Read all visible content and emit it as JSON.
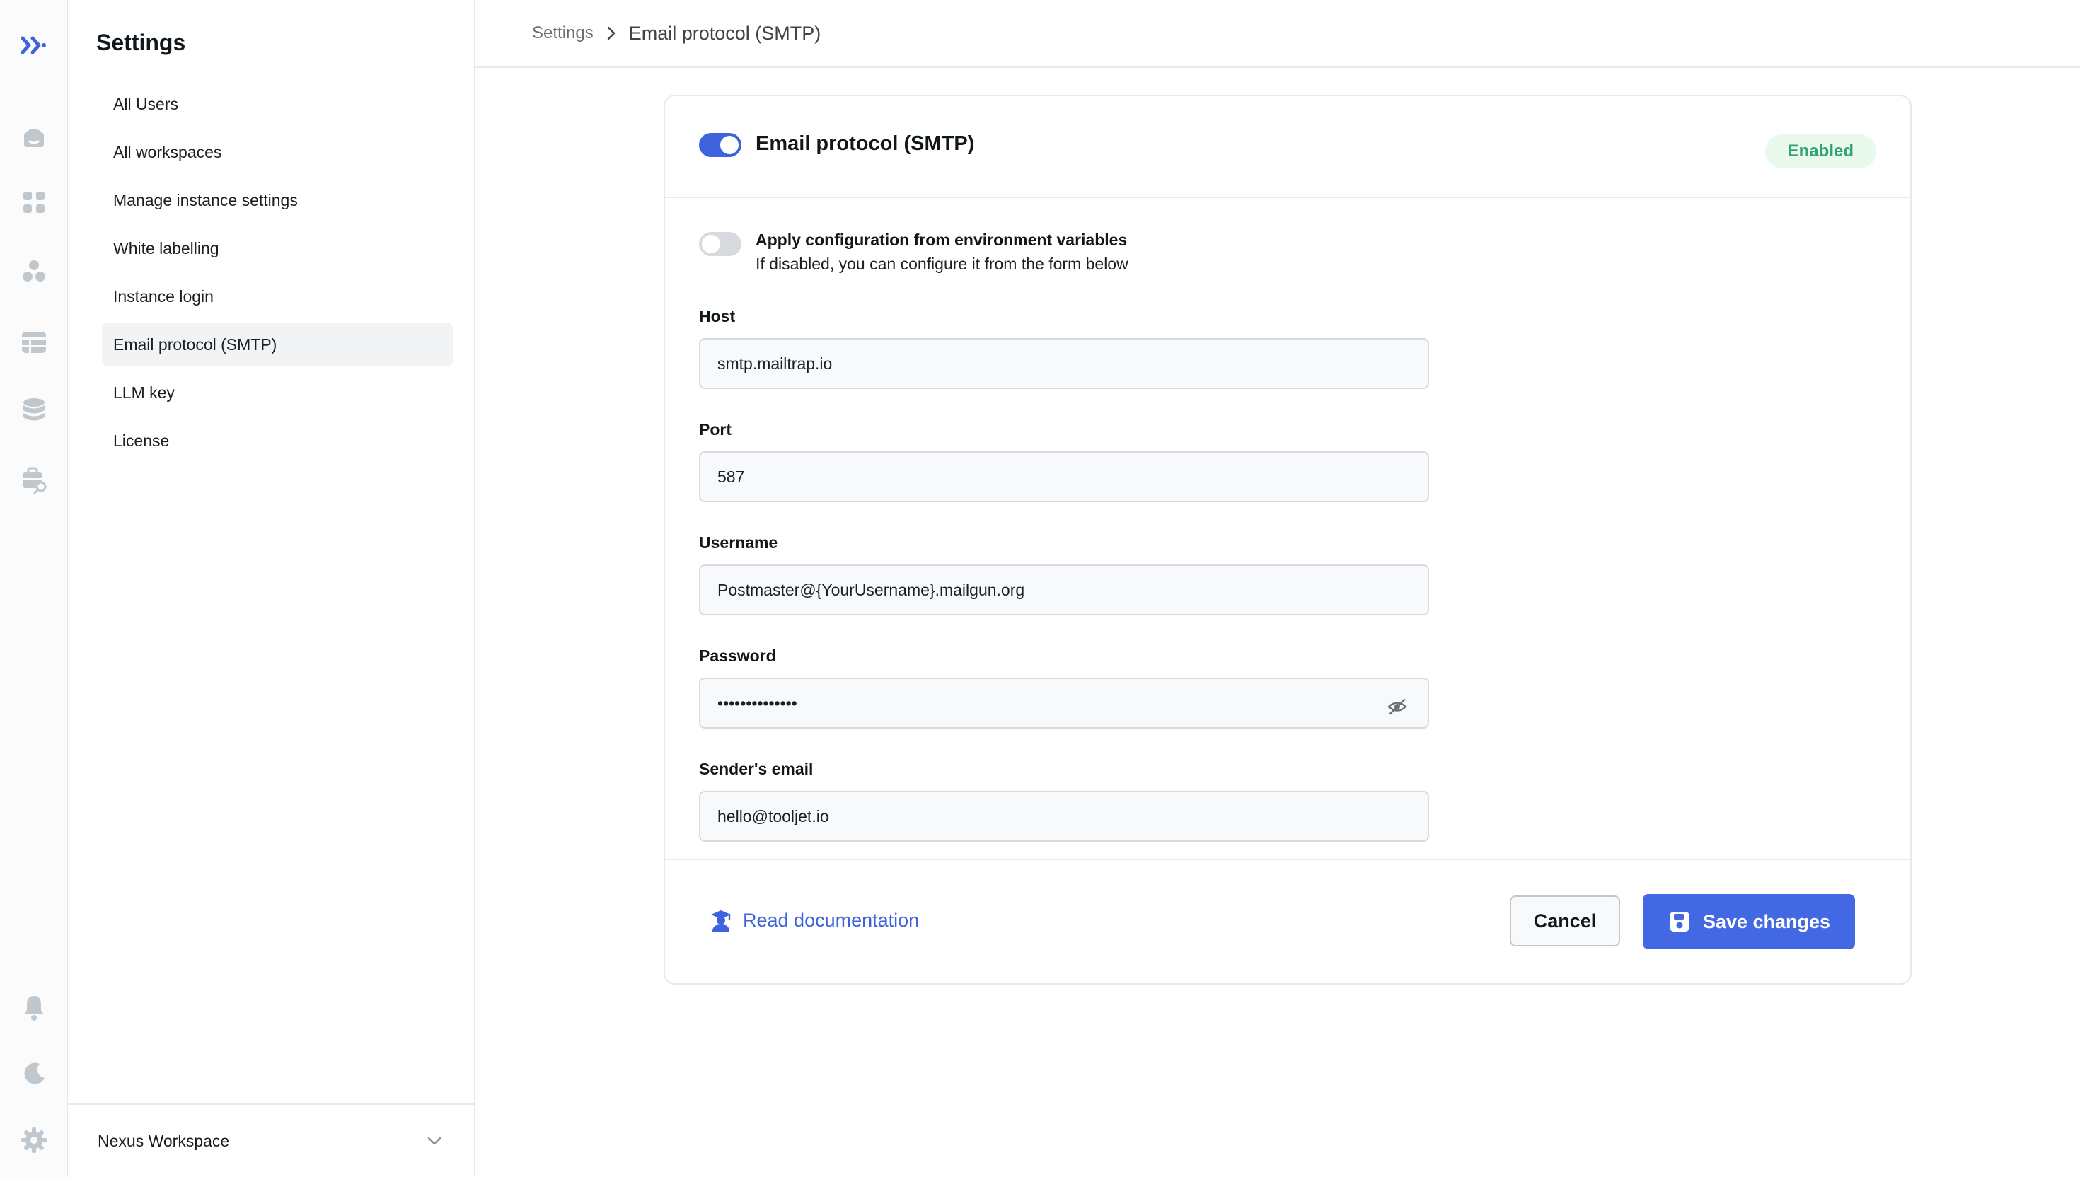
{
  "rail": {
    "items": [
      {
        "icon": "logo-icon"
      },
      {
        "icon": "home-icon"
      },
      {
        "icon": "apps-icon"
      },
      {
        "icon": "components-icon"
      },
      {
        "icon": "database-table-icon"
      },
      {
        "icon": "datasources-icon"
      },
      {
        "icon": "marketplace-icon"
      },
      {
        "icon": "notification-bell-icon"
      },
      {
        "icon": "theme-moon-icon"
      },
      {
        "icon": "settings-gear-icon"
      }
    ]
  },
  "sidebar": {
    "title": "Settings",
    "items": [
      {
        "label": "All Users"
      },
      {
        "label": "All workspaces"
      },
      {
        "label": "Manage instance settings"
      },
      {
        "label": "White labelling"
      },
      {
        "label": "Instance login"
      },
      {
        "label": "Email protocol (SMTP)",
        "active": true
      },
      {
        "label": "LLM key"
      },
      {
        "label": "License"
      }
    ],
    "workspace": "Nexus Workspace"
  },
  "breadcrumb": {
    "root": "Settings",
    "current": "Email protocol (SMTP)"
  },
  "card": {
    "title": "Email protocol (SMTP)",
    "status_badge": "Enabled",
    "smtp_enabled": true,
    "env": {
      "title": "Apply configuration from environment variables",
      "description": "If disabled, you can configure it from the form below",
      "enabled": false
    },
    "fields": {
      "host": {
        "label": "Host",
        "value": "smtp.mailtrap.io"
      },
      "port": {
        "label": "Port",
        "value": "587"
      },
      "username": {
        "label": "Username",
        "value": "Postmaster@{YourUsername}.mailgun.org"
      },
      "password": {
        "label": "Password",
        "value": "••••••••••••••"
      },
      "sender": {
        "label": "Sender's email",
        "value": "hello@tooljet.io"
      }
    },
    "footer": {
      "doc_link": "Read documentation",
      "cancel_label": "Cancel",
      "save_label": "Save changes"
    }
  },
  "colors": {
    "accent": "#3e63dd",
    "save_button": "#4368e3",
    "badge_bg": "#e9f9ee",
    "badge_text": "#30a46c"
  }
}
